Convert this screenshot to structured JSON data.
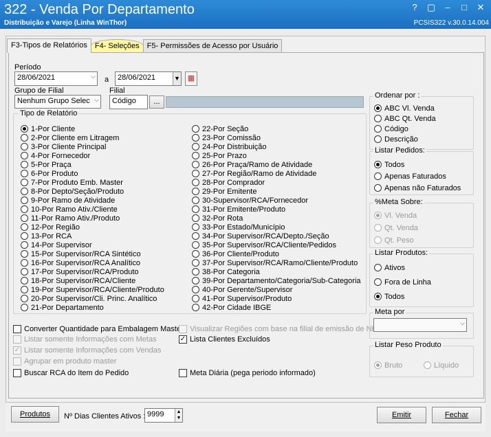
{
  "window": {
    "title": "322 - Venda Por Departamento",
    "subtitle": "Distribuição e Varejo (Linha WinThor)",
    "version": "PCSIS322  v.30.0.14.004",
    "help": "?"
  },
  "tabs": [
    "F3-Tipos de Relatórios",
    "F4- Seleções",
    "F5- Permissões de Acesso por Usuário"
  ],
  "periodo": {
    "label": "Período",
    "start": "28/06/2021",
    "sep": "a",
    "end": "28/06/2021"
  },
  "grupo_filial": {
    "label": "Grupo de Filial",
    "value": "Nenhum Grupo Selec"
  },
  "filial": {
    "label": "Filial",
    "placeholder": "Código",
    "button": "..."
  },
  "tipo_relatorio": {
    "title": "Tipo de Relatório",
    "left": [
      "1-Por Cliente",
      "2-Por Cliente em Litragem",
      "3-Por Cliente Principal",
      "4-Por Fornecedor",
      "5-Por Praça",
      "6-Por Produto",
      "7-Por Produto Emb. Master",
      "8-Por Depto/Seção/Produto",
      "9-Por Ramo de Atividade",
      "10-Por Ramo Ativ./Cliente",
      "11-Por Ramo Ativ./Produto",
      "12-Por Região",
      "13-Por RCA",
      "14-Por Supervisor",
      "15-Por Supervisor/RCA Sintético",
      "16-Por Supervisor/RCA Analítico",
      "17-Por Supervisor/RCA/Produto",
      "18-Por Supervisor/RCA/Cliente",
      "19-Por Supervisor/RCA/Cliente/Produto",
      "20-Por Supervisor/Cli. Princ. Analítico",
      "21-Por Departamento"
    ],
    "right": [
      "22-Por Seção",
      "23-Por Comissão",
      "24-Por Distribuição",
      "25-Por Prazo",
      "26-Por Praça/Ramo de Atividade",
      "27-Por Região/Ramo de Atividade",
      "28-Por Comprador",
      "29-Por Emitente",
      "30-Supervisor/RCA/Fornecedor",
      "31-Por Emitente/Produto",
      "32-Por Rota",
      "33-Por Estado/Município",
      "34-Por Supervisor/RCA/Depto./Seção",
      "35-Por Supervisor/RCA/Cliente/Pedidos",
      "36-Por Cliente/Produto",
      "37-Por Supervisor/RCA/Ramo/Cliente/Produto",
      "38-Por Categoria",
      "39-Por Departamento/Categoria/Sub-Categoria",
      "40-Por Gerente/Supervisor",
      "41-Por Supervisor/Produto",
      "42-Por Cidade IBGE"
    ],
    "selected": "1-Por Cliente"
  },
  "options": {
    "converter": "Converter Quantidade para Embalagem Master",
    "visualizar_regioes": "Visualizar Regiões com base na filial de emissão de NF",
    "listar_metas": "Listar somente Informações com Metas",
    "lista_excluidos": "Lista Clientes Excluídos",
    "listar_vendas": "Listar somente Informações com Vendas",
    "agrupar_master": "Agrupar em produto master",
    "buscar_rca": "Buscar RCA do Item do Pedido",
    "meta_diaria": "Meta Diária (pega periodo informado)"
  },
  "ordenar": {
    "title": "Ordenar por :",
    "items": [
      "ABC Vl. Venda",
      "ABC Qt. Venda",
      "Código",
      "Descrição"
    ],
    "selected": "ABC Vl. Venda"
  },
  "listar_pedidos": {
    "title": "Listar Pedidos:",
    "items": [
      "Todos",
      "Apenas Faturados",
      "Apenas não Faturados"
    ],
    "selected": "Todos"
  },
  "meta_sobre": {
    "title": "%Meta Sobre:",
    "items": [
      "Vl. Venda",
      "Qt. Venda",
      "Qt. Peso"
    ],
    "selected": "Vl. Venda"
  },
  "listar_produtos": {
    "title": "Listar Produtos:",
    "items": [
      "Ativos",
      "Fora de Linha",
      "Todos"
    ],
    "selected": "Todos"
  },
  "meta_por": {
    "title": "Meta por",
    "value": ""
  },
  "listar_peso": {
    "title": "Listar Peso Produto",
    "items": [
      "Bruto",
      "Líquido"
    ],
    "selected": "Bruto"
  },
  "footer": {
    "produtos": "Produtos",
    "dias_label": "Nº Dias Clientes Ativos :",
    "dias_value": "9999",
    "emitir": "Emitir",
    "fechar": "Fechar"
  }
}
